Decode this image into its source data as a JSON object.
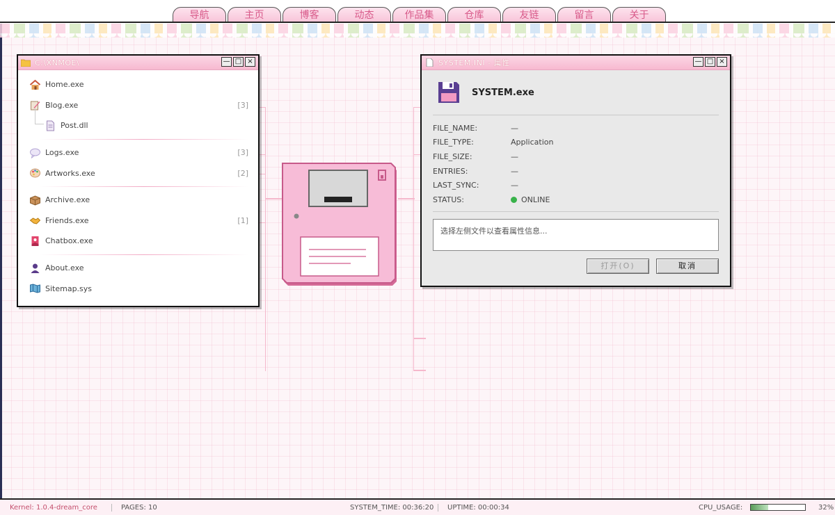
{
  "nav": {
    "tabs": [
      "导航",
      "主页",
      "博客",
      "动态",
      "作品集",
      "仓库",
      "友链",
      "留言",
      "关于"
    ]
  },
  "explorer": {
    "title": "C:\\XNMOE\\",
    "items": [
      {
        "label": "Home.exe",
        "count": "",
        "icon": "house-icon"
      },
      {
        "label": "Blog.exe",
        "count": "[3]",
        "icon": "pencil-icon"
      },
      {
        "label": "Post.dll",
        "count": "",
        "icon": "document-icon"
      },
      {
        "label": "Logs.exe",
        "count": "[3]",
        "icon": "speech-bubble-icon"
      },
      {
        "label": "Artworks.exe",
        "count": "[2]",
        "icon": "palette-icon"
      },
      {
        "label": "Archive.exe",
        "count": "",
        "icon": "box-icon"
      },
      {
        "label": "Friends.exe",
        "count": "[1]",
        "icon": "handshake-icon"
      },
      {
        "label": "Chatbox.exe",
        "count": "",
        "icon": "chat-flag-icon"
      },
      {
        "label": "About.exe",
        "count": "",
        "icon": "person-icon"
      },
      {
        "label": "Sitemap.sys",
        "count": "",
        "icon": "map-icon"
      }
    ]
  },
  "props": {
    "title": "SYSTEM.INI - 属性",
    "name": "SYSTEM.exe",
    "rows": [
      {
        "key": "FILE_NAME:",
        "value": "—"
      },
      {
        "key": "FILE_TYPE:",
        "value": "Application"
      },
      {
        "key": "FILE_SIZE:",
        "value": "—"
      },
      {
        "key": "ENTRIES:",
        "value": "—"
      },
      {
        "key": "LAST_SYNC:",
        "value": "—"
      },
      {
        "key": "STATUS:",
        "value": "ONLINE"
      }
    ],
    "info": "选择左侧文件以查看属性信息...",
    "open_label": "打开(O)",
    "cancel_label": "取消"
  },
  "window_buttons": {
    "min": "—",
    "max": "□",
    "close": "×"
  },
  "statusbar": {
    "kernel": "Kernel: 1.0.4-dream_core",
    "pages": "PAGES: 10",
    "system_time": "SYSTEM_TIME: 00:36:20",
    "uptime": "UPTIME: 00:00:34",
    "cpu_label": "CPU_USAGE:",
    "cpu_value": "32%",
    "cpu_fraction": 0.32
  },
  "colors": {
    "accent": "#f7b9d0",
    "online": "#38b24a",
    "kernel": "#c44f6d"
  }
}
